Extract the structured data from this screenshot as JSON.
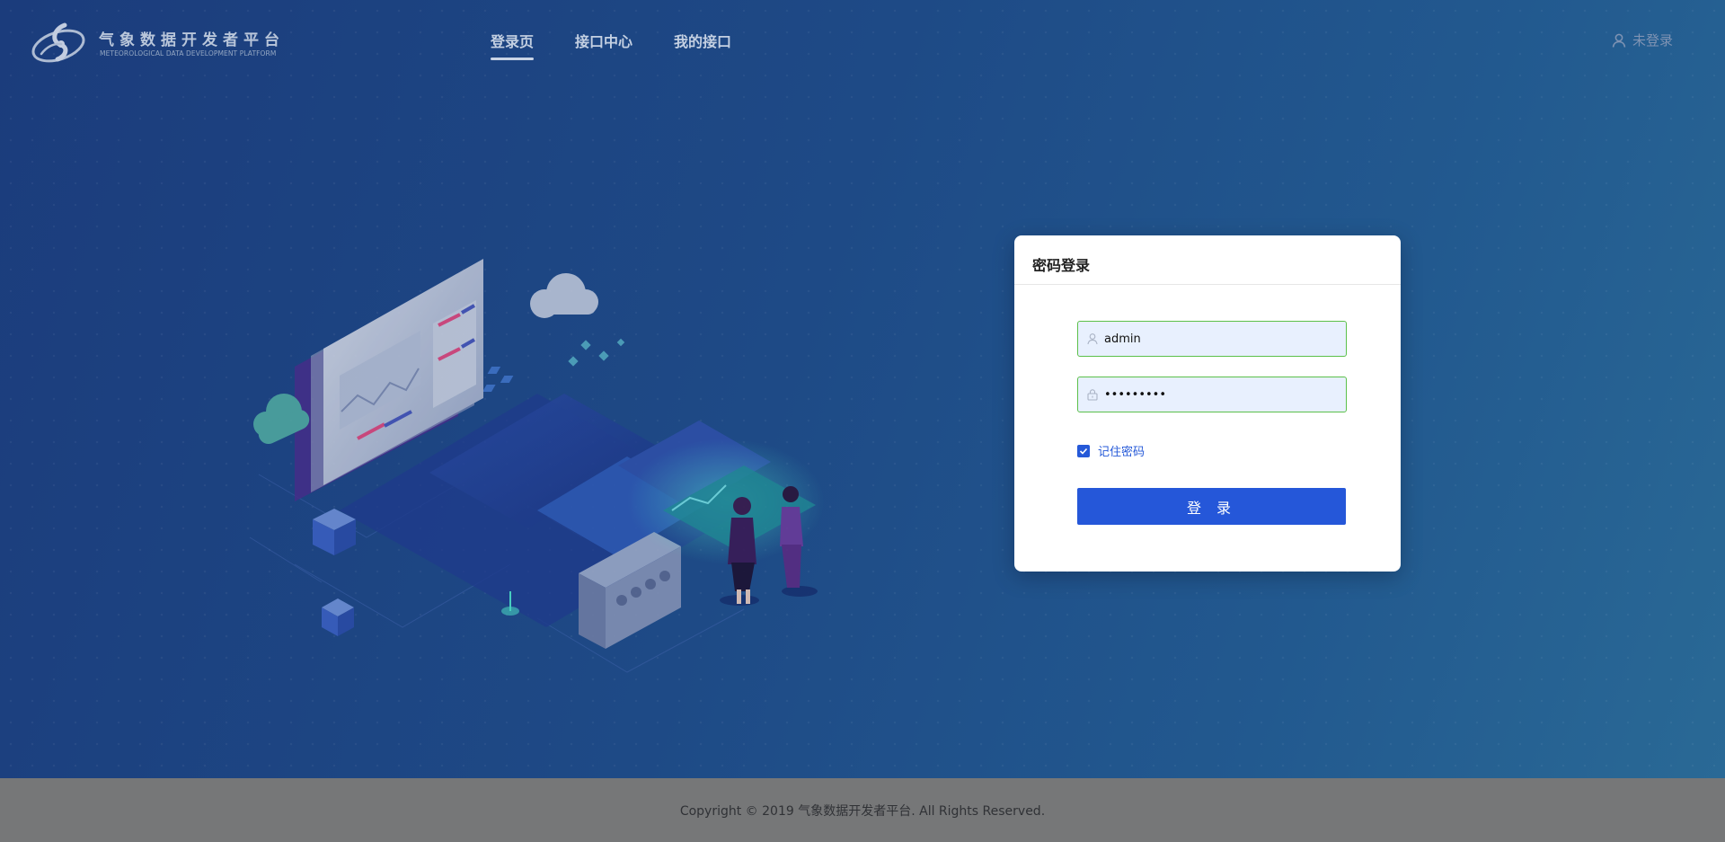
{
  "brand": {
    "title": "气象数据开发者平台",
    "subtitle": "METEOROLOGICAL DATA DEVELOPMENT PLATFORM"
  },
  "nav": {
    "items": [
      {
        "label": "登录页",
        "active": true
      },
      {
        "label": "接口中心",
        "active": false
      },
      {
        "label": "我的接口",
        "active": false
      }
    ]
  },
  "user": {
    "status": "未登录",
    "icon": "user-icon"
  },
  "login": {
    "title": "密码登录",
    "username_value": "admin",
    "password_value": "•••••••••",
    "remember_label": "记住密码",
    "remember_checked": true,
    "button_label": "登 录"
  },
  "footer": {
    "copyright": "Copyright © 2019 气象数据开发者平台. All Rights Reserved."
  },
  "colors": {
    "accent": "#2557d9",
    "field_border": "#5cc04a",
    "field_bg": "#e8f0fe",
    "footer_bg": "#767778"
  }
}
